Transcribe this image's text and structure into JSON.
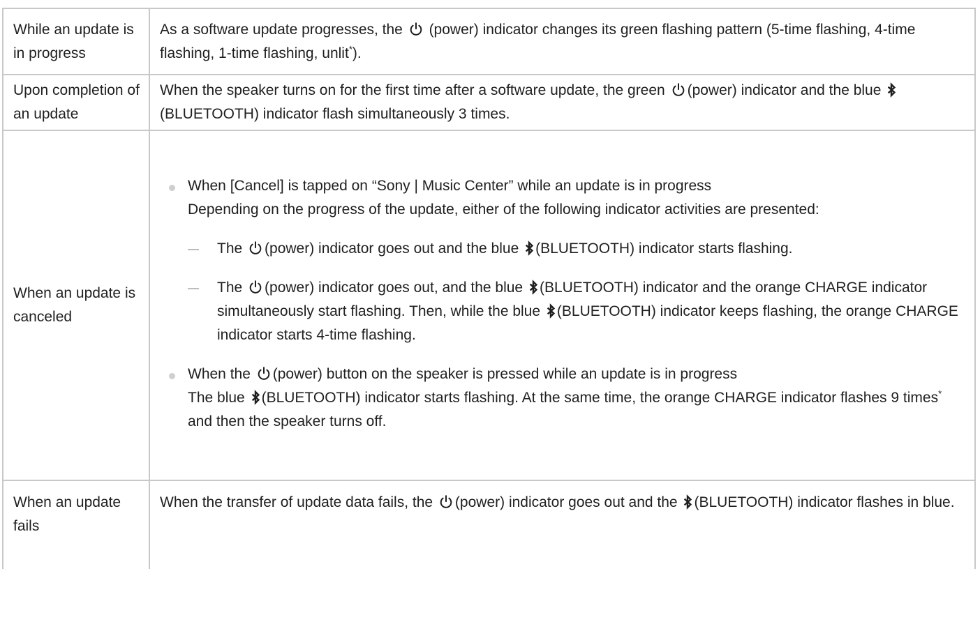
{
  "rows": [
    {
      "label": "While an update is in progress",
      "desc_a": "As a software update progresses, the",
      "desc_b": "(power) indicator changes its green flashing pattern (5-time flashing, 4-time flashing, 1-time flashing, unlit",
      "desc_sup": "*",
      "desc_c": ")."
    },
    {
      "label": "Upon completion of an update",
      "desc_a": "When the speaker turns on for the first time after a software update, the green",
      "desc_b": "(power) indicator and the blue",
      "desc_c": "(BLUETOOTH) indicator flash simultaneously 3 times."
    },
    {
      "label": "When an update is canceled",
      "b1_title": "When [Cancel] is tapped on “Sony | Music Center” while an update is in progress",
      "b1_text": "Depending on the progress of the update, either of the following indicator activities are presented:",
      "d1_a": "The",
      "d1_b": "(power) indicator goes out and the blue",
      "d1_c": "(BLUETOOTH) indicator starts flashing.",
      "d2_a": "The",
      "d2_b": "(power) indicator goes out, and the blue",
      "d2_c": "(BLUETOOTH) indicator and the orange CHARGE indicator simultaneously start flashing. Then, while the blue",
      "d2_d": "(BLUETOOTH) indicator keeps flashing, the orange CHARGE indicator starts 4-time flashing.",
      "b2_title_a": "When the",
      "b2_title_b": "(power) button on the speaker is pressed while an update is in progress",
      "b2_text_a": "The blue",
      "b2_text_b": "(BLUETOOTH) indicator starts flashing. At the same time, the orange CHARGE indicator flashes 9 times",
      "b2_sup": "*",
      "b2_text_c": "and then the speaker turns off."
    },
    {
      "label": "When an update fails",
      "desc_a": "When the transfer of update data fails, the",
      "desc_b": "(power) indicator goes out and the",
      "desc_c": "(BLUETOOTH) indicator flashes in blue."
    }
  ],
  "icons": {
    "power": "power-icon",
    "bluetooth": "bluetooth-icon"
  }
}
